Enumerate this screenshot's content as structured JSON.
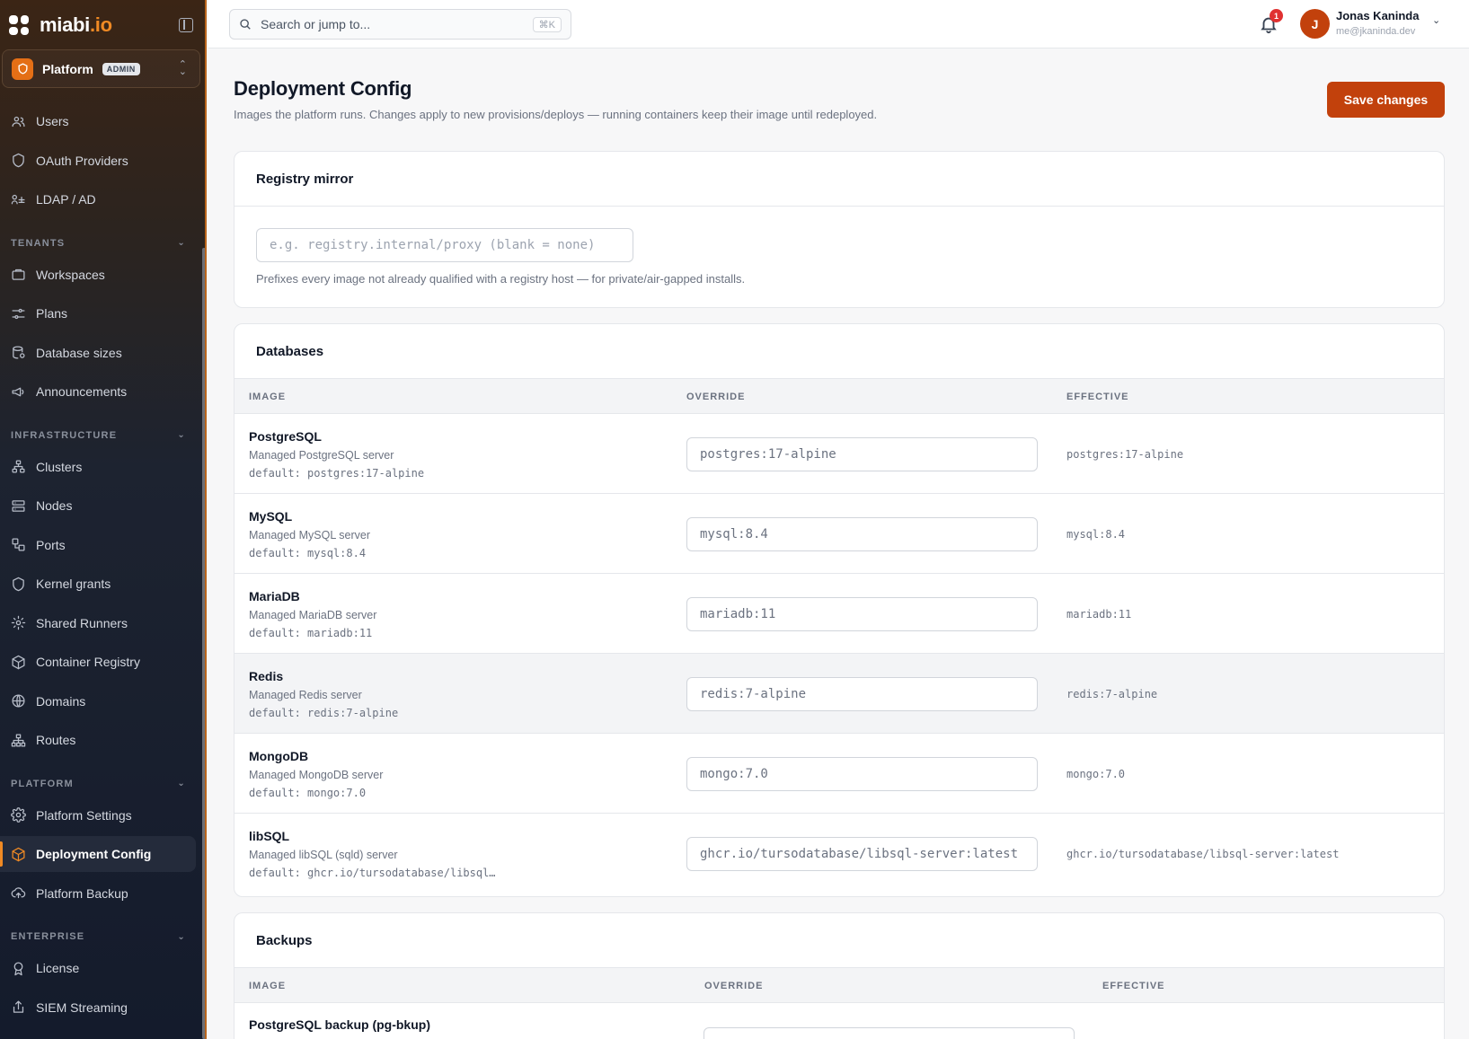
{
  "brand": {
    "name": "miabi",
    "suffix": ".io"
  },
  "workspace": {
    "name": "Platform",
    "badge": "ADMIN"
  },
  "sidebar": {
    "top_items": [
      {
        "label": "Users",
        "icon": "users-icon"
      },
      {
        "label": "OAuth Providers",
        "icon": "shield-icon"
      },
      {
        "label": "LDAP / AD",
        "icon": "ldap-icon"
      }
    ],
    "sections": [
      {
        "label": "TENANTS",
        "items": [
          {
            "label": "Workspaces",
            "icon": "briefcase-icon"
          },
          {
            "label": "Plans",
            "icon": "sliders-icon"
          },
          {
            "label": "Database sizes",
            "icon": "database-icon"
          },
          {
            "label": "Announcements",
            "icon": "megaphone-icon"
          }
        ]
      },
      {
        "label": "INFRASTRUCTURE",
        "items": [
          {
            "label": "Clusters",
            "icon": "cluster-icon"
          },
          {
            "label": "Nodes",
            "icon": "server-icon"
          },
          {
            "label": "Ports",
            "icon": "ports-icon"
          },
          {
            "label": "Kernel grants",
            "icon": "shield-icon"
          },
          {
            "label": "Shared Runners",
            "icon": "cog-icon"
          },
          {
            "label": "Container Registry",
            "icon": "box-icon"
          },
          {
            "label": "Domains",
            "icon": "globe-icon"
          },
          {
            "label": "Routes",
            "icon": "sitemap-icon"
          }
        ]
      },
      {
        "label": "PLATFORM",
        "items": [
          {
            "label": "Platform Settings",
            "icon": "gear-icon"
          },
          {
            "label": "Deployment Config",
            "icon": "box-icon",
            "active": true
          },
          {
            "label": "Platform Backup",
            "icon": "cloud-upload-icon"
          }
        ]
      },
      {
        "label": "ENTERPRISE",
        "items": [
          {
            "label": "License",
            "icon": "award-icon"
          },
          {
            "label": "SIEM Streaming",
            "icon": "export-icon"
          }
        ]
      }
    ]
  },
  "search": {
    "placeholder": "Search or jump to...",
    "shortcut": "⌘K"
  },
  "notifications": {
    "count": "1"
  },
  "user": {
    "initial": "J",
    "name": "Jonas Kaninda",
    "email": "me@jkaninda.dev"
  },
  "page": {
    "title": "Deployment Config",
    "subtitle": "Images the platform runs. Changes apply to new provisions/deploys — running containers keep their image until redeployed.",
    "save_label": "Save changes"
  },
  "registry_mirror": {
    "title": "Registry mirror",
    "placeholder": "e.g. registry.internal/proxy (blank = none)",
    "help": "Prefixes every image not already qualified with a registry host — for private/air-gapped installs."
  },
  "databases": {
    "title": "Databases",
    "columns": [
      "IMAGE",
      "OVERRIDE",
      "EFFECTIVE"
    ],
    "rows": [
      {
        "name": "PostgreSQL",
        "desc": "Managed PostgreSQL server",
        "default": "default: postgres:17-alpine",
        "placeholder": "postgres:17-alpine",
        "effective": "postgres:17-alpine"
      },
      {
        "name": "MySQL",
        "desc": "Managed MySQL server",
        "default": "default: mysql:8.4",
        "placeholder": "mysql:8.4",
        "effective": "mysql:8.4"
      },
      {
        "name": "MariaDB",
        "desc": "Managed MariaDB server",
        "default": "default: mariadb:11",
        "placeholder": "mariadb:11",
        "effective": "mariadb:11"
      },
      {
        "name": "Redis",
        "desc": "Managed Redis server",
        "default": "default: redis:7-alpine",
        "placeholder": "redis:7-alpine",
        "effective": "redis:7-alpine"
      },
      {
        "name": "MongoDB",
        "desc": "Managed MongoDB server",
        "default": "default: mongo:7.0",
        "placeholder": "mongo:7.0",
        "effective": "mongo:7.0"
      },
      {
        "name": "libSQL",
        "desc": "Managed libSQL (sqld) server",
        "default": "default: ghcr.io/tursodatabase/libsql…",
        "placeholder": "ghcr.io/tursodatabase/libsql-server:latest",
        "effective": "ghcr.io/tursodatabase/libsql-server:latest"
      }
    ]
  },
  "backups": {
    "title": "Backups",
    "columns": [
      "IMAGE",
      "OVERRIDE",
      "EFFECTIVE"
    ],
    "rows": [
      {
        "name": "PostgreSQL backup (pg-bkup)"
      }
    ]
  }
}
